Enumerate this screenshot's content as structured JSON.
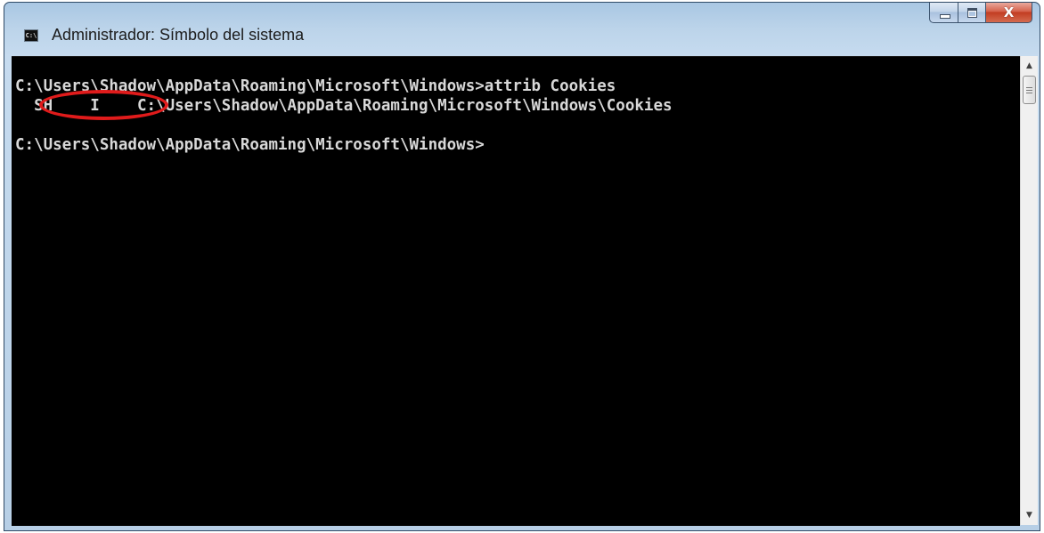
{
  "window": {
    "title": "Administrador: Símbolo del sistema",
    "icon": "cmd-icon",
    "icon_text": "C:\\",
    "buttons": {
      "minimize": "minimize-icon",
      "maximize": "maximize-icon",
      "close": "close-icon"
    }
  },
  "console": {
    "lines": [
      "C:\\Users\\Shadow\\AppData\\Roaming\\Microsoft\\Windows>attrib Cookies",
      "  SH    I    C:\\Users\\Shadow\\AppData\\Roaming\\Microsoft\\Windows\\Cookies",
      "",
      "C:\\Users\\Shadow\\AppData\\Roaming\\Microsoft\\Windows>"
    ],
    "text_color": "#d8d8d8",
    "background_color": "#000000"
  },
  "annotation": {
    "shape": "ellipse",
    "color": "#e01b1b",
    "target": "SH    I"
  },
  "scrollbar": {
    "up_arrow": "▲",
    "down_arrow": "▼"
  }
}
